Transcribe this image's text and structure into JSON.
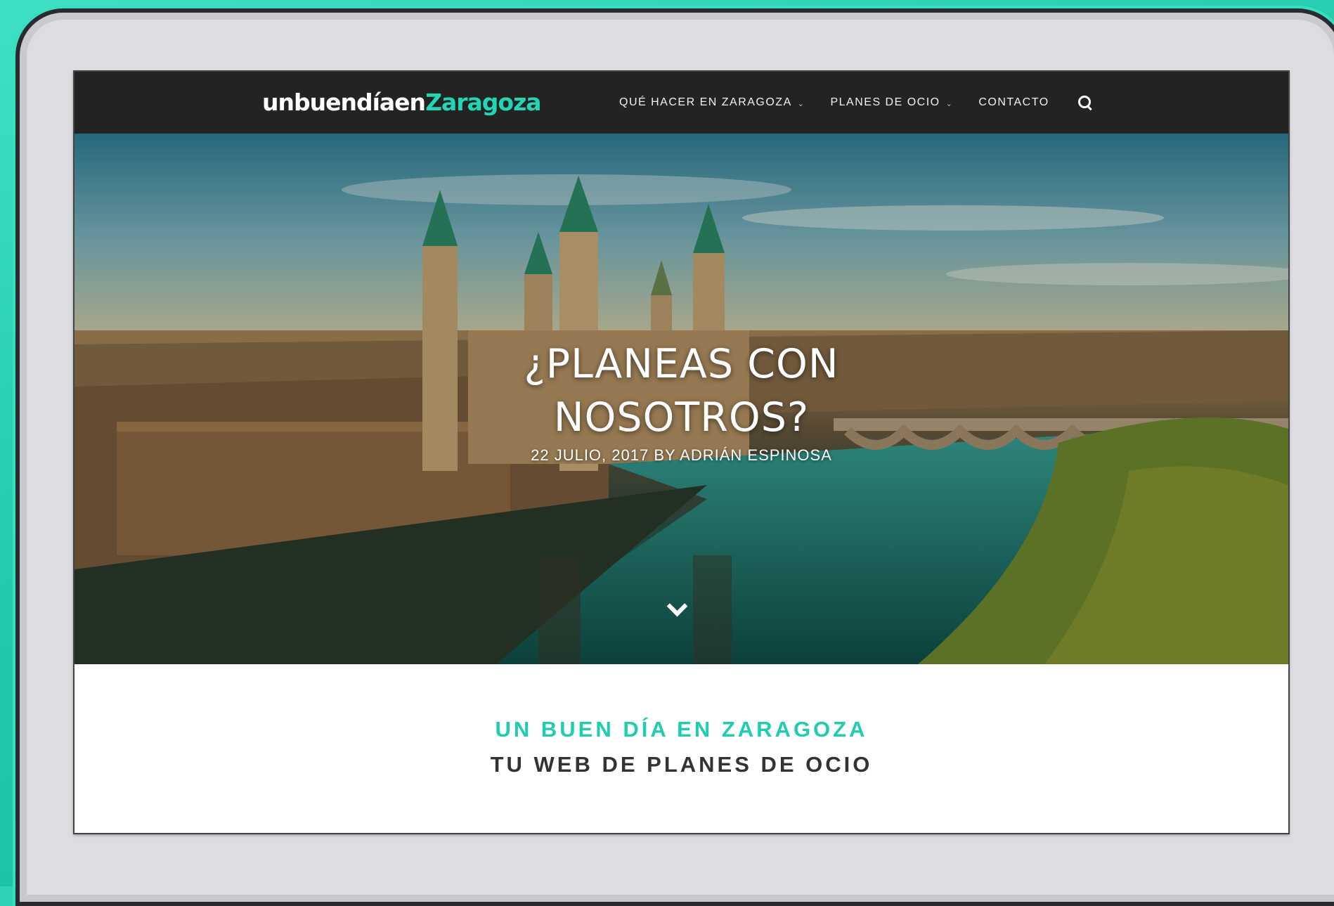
{
  "header": {
    "logo_part1": "unbuendíaen",
    "logo_part2": "Zaragoza",
    "nav": [
      {
        "label": "QUÉ HACER EN ZARAGOZA",
        "has_dropdown": true
      },
      {
        "label": "PLANES DE OCIO",
        "has_dropdown": true
      },
      {
        "label": "CONTACTO",
        "has_dropdown": false
      }
    ],
    "search_icon": "search-icon"
  },
  "hero": {
    "title_line1": "¿PLANEAS CON",
    "title_line2": "NOSOTROS?",
    "meta": "22 JULIO, 2017 BY ADRIÁN ESPINOSA",
    "scroll_icon": "chevron-down-icon"
  },
  "intro": {
    "title": "UN BUEN DÍA EN ZARAGOZA",
    "subtitle": "TU WEB DE PLANES DE OCIO"
  },
  "colors": {
    "accent": "#21d6b4",
    "header_bg": "#232323",
    "frame_bg": "#2fd3b3"
  }
}
